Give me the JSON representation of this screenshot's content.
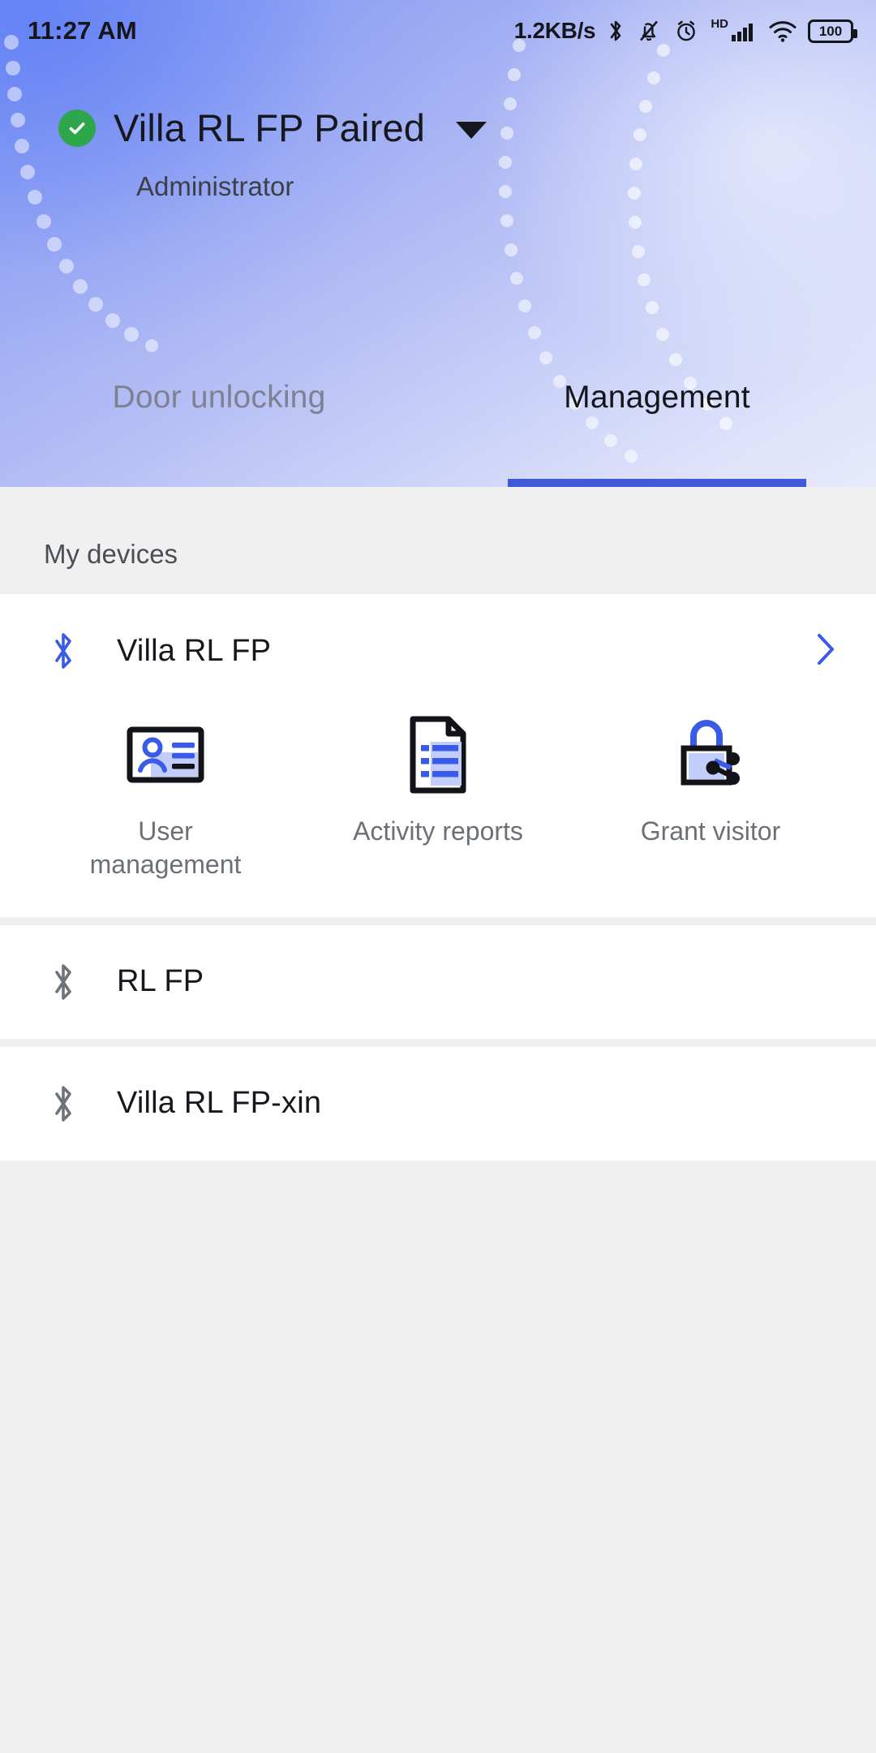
{
  "status_bar": {
    "time": "11:27 AM",
    "network_speed": "1.2KB/s",
    "hd_label": "HD",
    "battery_level": "100",
    "icons": [
      "bluetooth-icon",
      "mute-bell-icon",
      "alarm-clock-icon",
      "hd-badge",
      "signal-bars-icon",
      "wifi-icon",
      "battery-icon"
    ]
  },
  "header": {
    "device_title": "Villa RL FP Paired",
    "role": "Administrator",
    "paired_status_icon": "check-circle-icon",
    "dropdown_icon": "caret-down-icon",
    "accent_color": "#4059d9",
    "paired_color": "#2ea64b"
  },
  "tabs": [
    {
      "label": "Door unlocking",
      "active": false
    },
    {
      "label": "Management",
      "active": true
    }
  ],
  "main": {
    "section_title": "My devices",
    "devices": [
      {
        "name": "Villa RL FP",
        "icon": "bluetooth-icon",
        "connected": true,
        "chevron": "chevron-right-icon",
        "actions": [
          {
            "label": "User management",
            "icon": "id-card-user-icon"
          },
          {
            "label": "Activity reports",
            "icon": "document-list-icon"
          },
          {
            "label": "Grant visitor",
            "icon": "lock-share-icon"
          }
        ]
      },
      {
        "name": "RL FP",
        "icon": "bluetooth-icon",
        "connected": false
      },
      {
        "name": "Villa RL FP-xin",
        "icon": "bluetooth-icon",
        "connected": false
      }
    ]
  }
}
